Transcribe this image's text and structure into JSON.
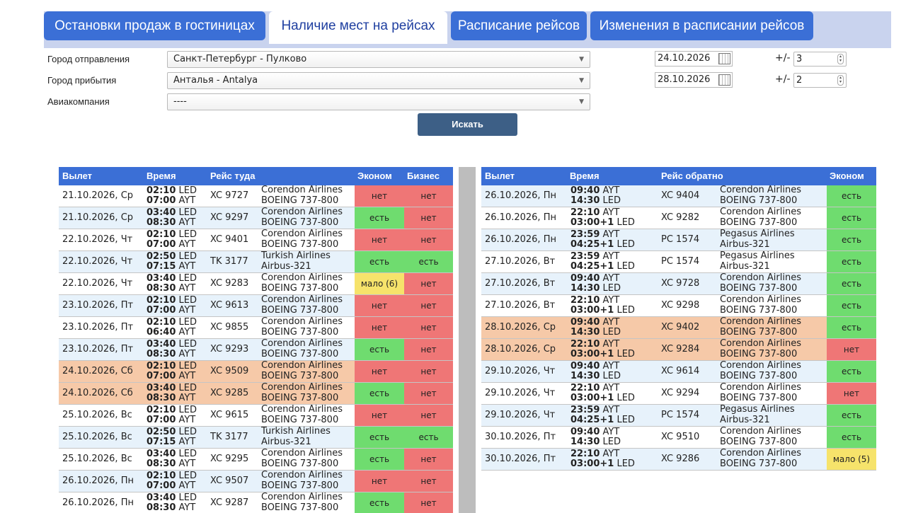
{
  "tabs": [
    {
      "label": "Остановки продаж в гостиницах",
      "active": false
    },
    {
      "label": "Наличие мест на рейсах",
      "active": true
    },
    {
      "label": "Расписание рейсов",
      "active": false
    },
    {
      "label": "Изменения в расписании рейсов",
      "active": false
    }
  ],
  "form": {
    "departure_label": "Город отправления",
    "departure_value": "Санкт-Петербург - Пулково",
    "arrival_label": "Город прибытия",
    "arrival_value": "Анталья - Antalya",
    "airline_label": "Авиакомпания",
    "airline_value": "----",
    "date_out": "24.10.2026",
    "date_back": "28.10.2026",
    "plusminus": "+/-",
    "range_out": "3",
    "range_back": "2",
    "search_label": "Искать"
  },
  "colors": {
    "header": "#3b6fd6",
    "yes": "#6fdc6f",
    "no": "#ef7676",
    "few": "#f6e36b",
    "highlight": "#f6c9a8",
    "row_alt": "#e7f2fb"
  },
  "outbound": {
    "headers": {
      "date": "Вылет",
      "time": "Время",
      "flight": "Рейс туда",
      "economy": "Эконом",
      "business": "Бизнес"
    },
    "rows": [
      {
        "date": "21.10.2026, Ср",
        "t1": "02:10",
        "a1": "LED",
        "t2": "07:00",
        "a2": "AYT",
        "flight": "XC 9727",
        "airline": "Corendon Airlines",
        "aircraft": "BOEING 737-800",
        "eco": "нет",
        "eco_s": "no",
        "bus": "нет",
        "bus_s": "no",
        "bg": "white"
      },
      {
        "date": "21.10.2026, Ср",
        "t1": "03:40",
        "a1": "LED",
        "t2": "08:30",
        "a2": "AYT",
        "flight": "XC 9297",
        "airline": "Corendon Airlines",
        "aircraft": "BOEING 737-800",
        "eco": "есть",
        "eco_s": "yes",
        "bus": "нет",
        "bus_s": "no",
        "bg": "blue"
      },
      {
        "date": "22.10.2026, Чт",
        "t1": "02:10",
        "a1": "LED",
        "t2": "07:00",
        "a2": "AYT",
        "flight": "XC 9401",
        "airline": "Corendon Airlines",
        "aircraft": "BOEING 737-800",
        "eco": "нет",
        "eco_s": "no",
        "bus": "нет",
        "bus_s": "no",
        "bg": "white"
      },
      {
        "date": "22.10.2026, Чт",
        "t1": "02:50",
        "a1": "LED",
        "t2": "07:15",
        "a2": "AYT",
        "flight": "TK 3177",
        "airline": "Turkish Airlines",
        "aircraft": "Airbus-321",
        "eco": "есть",
        "eco_s": "yes",
        "bus": "есть",
        "bus_s": "yes",
        "bg": "blue"
      },
      {
        "date": "22.10.2026, Чт",
        "t1": "03:40",
        "a1": "LED",
        "t2": "08:30",
        "a2": "AYT",
        "flight": "XC 9283",
        "airline": "Corendon Airlines",
        "aircraft": "BOEING 737-800",
        "eco": "мало (6)",
        "eco_s": "few",
        "bus": "нет",
        "bus_s": "no",
        "bg": "white"
      },
      {
        "date": "23.10.2026, Пт",
        "t1": "02:10",
        "a1": "LED",
        "t2": "07:00",
        "a2": "AYT",
        "flight": "XC 9613",
        "airline": "Corendon Airlines",
        "aircraft": "BOEING 737-800",
        "eco": "нет",
        "eco_s": "no",
        "bus": "нет",
        "bus_s": "no",
        "bg": "blue"
      },
      {
        "date": "23.10.2026, Пт",
        "t1": "02:10",
        "a1": "LED",
        "t2": "06:40",
        "a2": "AYT",
        "flight": "XC 9855",
        "airline": "Corendon Airlines",
        "aircraft": "BOEING 737-800",
        "eco": "нет",
        "eco_s": "no",
        "bus": "нет",
        "bus_s": "no",
        "bg": "white"
      },
      {
        "date": "23.10.2026, Пт",
        "t1": "03:40",
        "a1": "LED",
        "t2": "08:30",
        "a2": "AYT",
        "flight": "XC 9293",
        "airline": "Corendon Airlines",
        "aircraft": "BOEING 737-800",
        "eco": "есть",
        "eco_s": "yes",
        "bus": "нет",
        "bus_s": "no",
        "bg": "blue"
      },
      {
        "date": "24.10.2026, Сб",
        "t1": "02:10",
        "a1": "LED",
        "t2": "07:00",
        "a2": "AYT",
        "flight": "XC 9509",
        "airline": "Corendon Airlines",
        "aircraft": "BOEING 737-800",
        "eco": "нет",
        "eco_s": "no",
        "bus": "нет",
        "bus_s": "no",
        "bg": "orange"
      },
      {
        "date": "24.10.2026, Сб",
        "t1": "03:40",
        "a1": "LED",
        "t2": "08:30",
        "a2": "AYT",
        "flight": "XC 9285",
        "airline": "Corendon Airlines",
        "aircraft": "BOEING 737-800",
        "eco": "есть",
        "eco_s": "yes",
        "bus": "нет",
        "bus_s": "no",
        "bg": "orange"
      },
      {
        "date": "25.10.2026, Вс",
        "t1": "02:10",
        "a1": "LED",
        "t2": "07:00",
        "a2": "AYT",
        "flight": "XC 9615",
        "airline": "Corendon Airlines",
        "aircraft": "BOEING 737-800",
        "eco": "нет",
        "eco_s": "no",
        "bus": "нет",
        "bus_s": "no",
        "bg": "white"
      },
      {
        "date": "25.10.2026, Вс",
        "t1": "02:50",
        "a1": "LED",
        "t2": "07:15",
        "a2": "AYT",
        "flight": "TK 3177",
        "airline": "Turkish Airlines",
        "aircraft": "Airbus-321",
        "eco": "есть",
        "eco_s": "yes",
        "bus": "есть",
        "bus_s": "yes",
        "bg": "blue"
      },
      {
        "date": "25.10.2026, Вс",
        "t1": "03:40",
        "a1": "LED",
        "t2": "08:30",
        "a2": "AYT",
        "flight": "XC 9295",
        "airline": "Corendon Airlines",
        "aircraft": "BOEING 737-800",
        "eco": "есть",
        "eco_s": "yes",
        "bus": "нет",
        "bus_s": "no",
        "bg": "white"
      },
      {
        "date": "26.10.2026, Пн",
        "t1": "02:10",
        "a1": "LED",
        "t2": "07:00",
        "a2": "AYT",
        "flight": "XC 9507",
        "airline": "Corendon Airlines",
        "aircraft": "BOEING 737-800",
        "eco": "нет",
        "eco_s": "no",
        "bus": "нет",
        "bus_s": "no",
        "bg": "blue"
      },
      {
        "date": "26.10.2026, Пн",
        "t1": "03:40",
        "a1": "LED",
        "t2": "08:30",
        "a2": "AYT",
        "flight": "XC 9287",
        "airline": "Corendon Airlines",
        "aircraft": "BOEING 737-800",
        "eco": "есть",
        "eco_s": "yes",
        "bus": "нет",
        "bus_s": "no",
        "bg": "white"
      }
    ]
  },
  "inbound": {
    "headers": {
      "date": "Вылет",
      "time": "Время",
      "flight": "Рейс обратно",
      "economy": "Эконом"
    },
    "rows": [
      {
        "date": "26.10.2026, Пн",
        "t1": "09:40",
        "a1": "AYT",
        "t2": "14:30",
        "a2": "LED",
        "flight": "XC 9404",
        "airline": "Corendon Airlines",
        "aircraft": "BOEING 737-800",
        "eco": "есть",
        "eco_s": "yes",
        "bg": "blue"
      },
      {
        "date": "26.10.2026, Пн",
        "t1": "22:10",
        "a1": "AYT",
        "t2": "03:00+1",
        "a2": "LED",
        "flight": "XC 9282",
        "airline": "Corendon Airlines",
        "aircraft": "BOEING 737-800",
        "eco": "есть",
        "eco_s": "yes",
        "bg": "white"
      },
      {
        "date": "26.10.2026, Пн",
        "t1": "23:59",
        "a1": "AYT",
        "t2": "04:25+1",
        "a2": "LED",
        "flight": "PC 1574",
        "airline": "Pegasus Airlines",
        "aircraft": "Airbus-321",
        "eco": "есть",
        "eco_s": "yes",
        "bg": "blue"
      },
      {
        "date": "27.10.2026, Вт",
        "t1": "23:59",
        "a1": "AYT",
        "t2": "04:25+1",
        "a2": "LED",
        "flight": "PC 1574",
        "airline": "Pegasus Airlines",
        "aircraft": "Airbus-321",
        "eco": "есть",
        "eco_s": "yes",
        "bg": "white"
      },
      {
        "date": "27.10.2026, Вт",
        "t1": "09:40",
        "a1": "AYT",
        "t2": "14:30",
        "a2": "LED",
        "flight": "XC 9728",
        "airline": "Corendon Airlines",
        "aircraft": "BOEING 737-800",
        "eco": "есть",
        "eco_s": "yes",
        "bg": "blue"
      },
      {
        "date": "27.10.2026, Вт",
        "t1": "22:10",
        "a1": "AYT",
        "t2": "03:00+1",
        "a2": "LED",
        "flight": "XC 9298",
        "airline": "Corendon Airlines",
        "aircraft": "BOEING 737-800",
        "eco": "есть",
        "eco_s": "yes",
        "bg": "white"
      },
      {
        "date": "28.10.2026, Ср",
        "t1": "09:40",
        "a1": "AYT",
        "t2": "14:30",
        "a2": "LED",
        "flight": "XC 9402",
        "airline": "Corendon Airlines",
        "aircraft": "BOEING 737-800",
        "eco": "есть",
        "eco_s": "yes",
        "bg": "orange"
      },
      {
        "date": "28.10.2026, Ср",
        "t1": "22:10",
        "a1": "AYT",
        "t2": "03:00+1",
        "a2": "LED",
        "flight": "XC 9284",
        "airline": "Corendon Airlines",
        "aircraft": "BOEING 737-800",
        "eco": "нет",
        "eco_s": "no",
        "bg": "orange"
      },
      {
        "date": "29.10.2026, Чт",
        "t1": "09:40",
        "a1": "AYT",
        "t2": "14:30",
        "a2": "LED",
        "flight": "XC 9614",
        "airline": "Corendon Airlines",
        "aircraft": "BOEING 737-800",
        "eco": "есть",
        "eco_s": "yes",
        "bg": "blue"
      },
      {
        "date": "29.10.2026, Чт",
        "t1": "22:10",
        "a1": "AYT",
        "t2": "03:00+1",
        "a2": "LED",
        "flight": "XC 9294",
        "airline": "Corendon Airlines",
        "aircraft": "BOEING 737-800",
        "eco": "нет",
        "eco_s": "no",
        "bg": "white"
      },
      {
        "date": "29.10.2026, Чт",
        "t1": "23:59",
        "a1": "AYT",
        "t2": "04:25+1",
        "a2": "LED",
        "flight": "PC 1574",
        "airline": "Pegasus Airlines",
        "aircraft": "Airbus-321",
        "eco": "есть",
        "eco_s": "yes",
        "bg": "blue"
      },
      {
        "date": "30.10.2026, Пт",
        "t1": "09:40",
        "a1": "AYT",
        "t2": "14:30",
        "a2": "LED",
        "flight": "XC 9510",
        "airline": "Corendon Airlines",
        "aircraft": "BOEING 737-800",
        "eco": "есть",
        "eco_s": "yes",
        "bg": "white"
      },
      {
        "date": "30.10.2026, Пт",
        "t1": "22:10",
        "a1": "AYT",
        "t2": "03:00+1",
        "a2": "LED",
        "flight": "XC 9286",
        "airline": "Corendon Airlines",
        "aircraft": "BOEING 737-800",
        "eco": "мало (5)",
        "eco_s": "few",
        "bg": "blue"
      }
    ]
  }
}
